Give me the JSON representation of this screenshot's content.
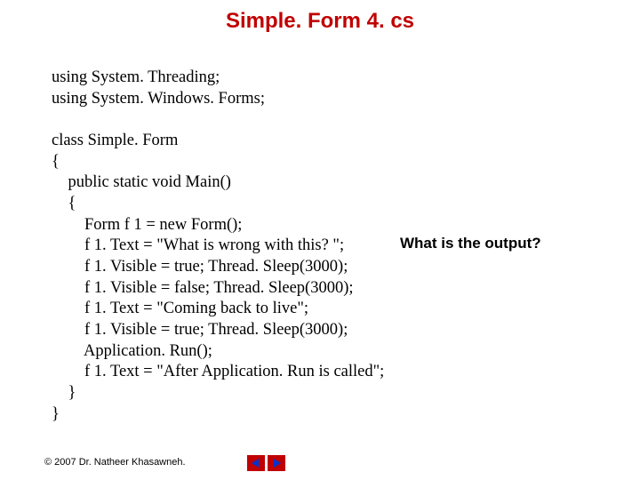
{
  "title": "Simple. Form 4. cs",
  "code": "using System. Threading;\nusing System. Windows. Forms;\n\nclass Simple. Form\n{\n    public static void Main()\n    {\n        Form f 1 = new Form();\n        f 1. Text = \"What is wrong with this? \";\n        f 1. Visible = true; Thread. Sleep(3000);\n        f 1. Visible = false; Thread. Sleep(3000);\n        f 1. Text = \"Coming back to live\";\n        f 1. Visible = true; Thread. Sleep(3000);\n        Application. Run();\n        f 1. Text = \"After Application. Run is called\";\n    }\n}",
  "annotation": "What is the output?",
  "footer": "© 2007 Dr. Natheer Khasawneh.",
  "nav": {
    "prev_icon": "triangle-left-icon",
    "next_icon": "triangle-right-icon"
  }
}
